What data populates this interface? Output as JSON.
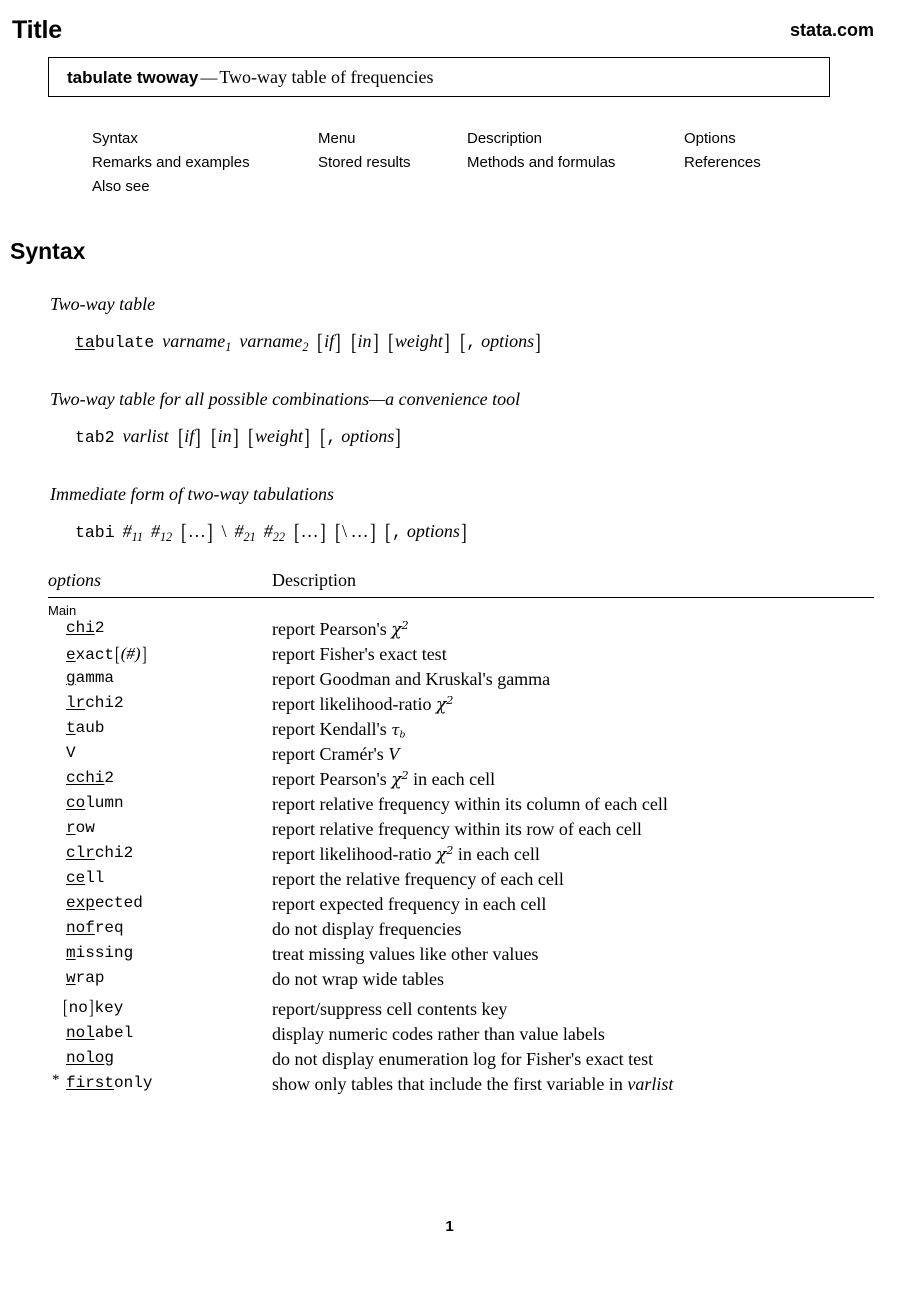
{
  "header": {
    "title": "Title",
    "site": "stata.com"
  },
  "titlebox": {
    "command": "tabulate twoway",
    "dash": "—",
    "description": "Two-way table of frequencies"
  },
  "toc": {
    "rows": [
      [
        "Syntax",
        "Menu",
        "Description",
        "Options"
      ],
      [
        "Remarks and examples",
        "Stored results",
        "Methods and formulas",
        "References"
      ],
      [
        "Also see",
        "",
        "",
        ""
      ]
    ]
  },
  "syntax": {
    "heading": "Syntax",
    "blocks": [
      {
        "subtitle": "Two-way table",
        "command": "tabulate",
        "command_abbrev": "ta",
        "command_rest": "bulate",
        "args": "varname1 varname2",
        "optional": "[if] [in] [weight] [, options]"
      },
      {
        "subtitle": "Two-way table for all possible combinations—a convenience tool",
        "command": "tab2",
        "args": "varlist",
        "optional": "[if] [in] [weight] [, options]"
      },
      {
        "subtitle": "Immediate form of two-way tabulations",
        "command": "tabi",
        "args": "#11 #12 [...] \\ #21 #22 [...] [\\ ...]",
        "optional": "[, options]"
      }
    ]
  },
  "options_table": {
    "col_options": "options",
    "col_description": "Description",
    "group_label": "Main",
    "footnote_marker": "*",
    "rows": [
      {
        "abbrev": "chi",
        "rest": "2",
        "desc_pre": "report Pearson's ",
        "math": "chi2",
        "desc_post": ""
      },
      {
        "abbrev": "e",
        "rest": "xact",
        "bracket": "(#)",
        "desc_pre": "report Fisher's exact test",
        "math": "",
        "desc_post": ""
      },
      {
        "abbrev": "g",
        "rest": "amma",
        "desc_pre": "report Goodman and Kruskal's gamma",
        "math": "",
        "desc_post": ""
      },
      {
        "abbrev": "lr",
        "rest": "chi2",
        "desc_pre": "report likelihood-ratio ",
        "math": "chi2",
        "desc_post": ""
      },
      {
        "abbrev": "t",
        "rest": "aub",
        "desc_pre": "report Kendall's ",
        "math": "taub",
        "desc_post": ""
      },
      {
        "abbrev": "",
        "rest": "V",
        "desc_pre": "report Cramér's ",
        "math": "V",
        "desc_post": ""
      },
      {
        "abbrev": "cchi",
        "rest": "2",
        "desc_pre": "report Pearson's ",
        "math": "chi2",
        "desc_post": " in each cell"
      },
      {
        "abbrev": "co",
        "rest": "lumn",
        "desc_pre": "report relative frequency within its column of each cell",
        "math": "",
        "desc_post": ""
      },
      {
        "abbrev": "r",
        "rest": "ow",
        "desc_pre": "report relative frequency within its row of each cell",
        "math": "",
        "desc_post": ""
      },
      {
        "abbrev": "clr",
        "rest": "chi2",
        "desc_pre": "report likelihood-ratio ",
        "math": "chi2",
        "desc_post": " in each cell"
      },
      {
        "abbrev": "ce",
        "rest": "ll",
        "desc_pre": "report the relative frequency of each cell",
        "math": "",
        "desc_post": ""
      },
      {
        "abbrev": "exp",
        "rest": "ected",
        "desc_pre": "report expected frequency in each cell",
        "math": "",
        "desc_post": ""
      },
      {
        "abbrev": "nof",
        "rest": "req",
        "desc_pre": "do not display frequencies",
        "math": "",
        "desc_post": ""
      },
      {
        "abbrev": "m",
        "rest": "issing",
        "desc_pre": "treat missing values like other values",
        "math": "",
        "desc_post": ""
      },
      {
        "abbrev": "w",
        "rest": "rap",
        "desc_pre": "do not wrap wide tables",
        "math": "",
        "desc_post": ""
      },
      {
        "prefix_bracket": "no",
        "abbrev": "",
        "rest": "key",
        "desc_pre": "report/suppress cell contents key",
        "math": "",
        "desc_post": "",
        "spaced": true
      },
      {
        "abbrev": "nol",
        "rest": "abel",
        "desc_pre": "display numeric codes rather than value labels",
        "math": "",
        "desc_post": ""
      },
      {
        "abbrev": "nolo",
        "rest": "g",
        "desc_pre": "do not display enumeration log for Fisher's exact test",
        "math": "",
        "desc_post": ""
      },
      {
        "star": true,
        "abbrev": "first",
        "rest": "only",
        "desc_pre": "show only tables that include the first variable in ",
        "math": "varlist",
        "desc_post": ""
      }
    ]
  },
  "footer": {
    "page_number": "1"
  }
}
